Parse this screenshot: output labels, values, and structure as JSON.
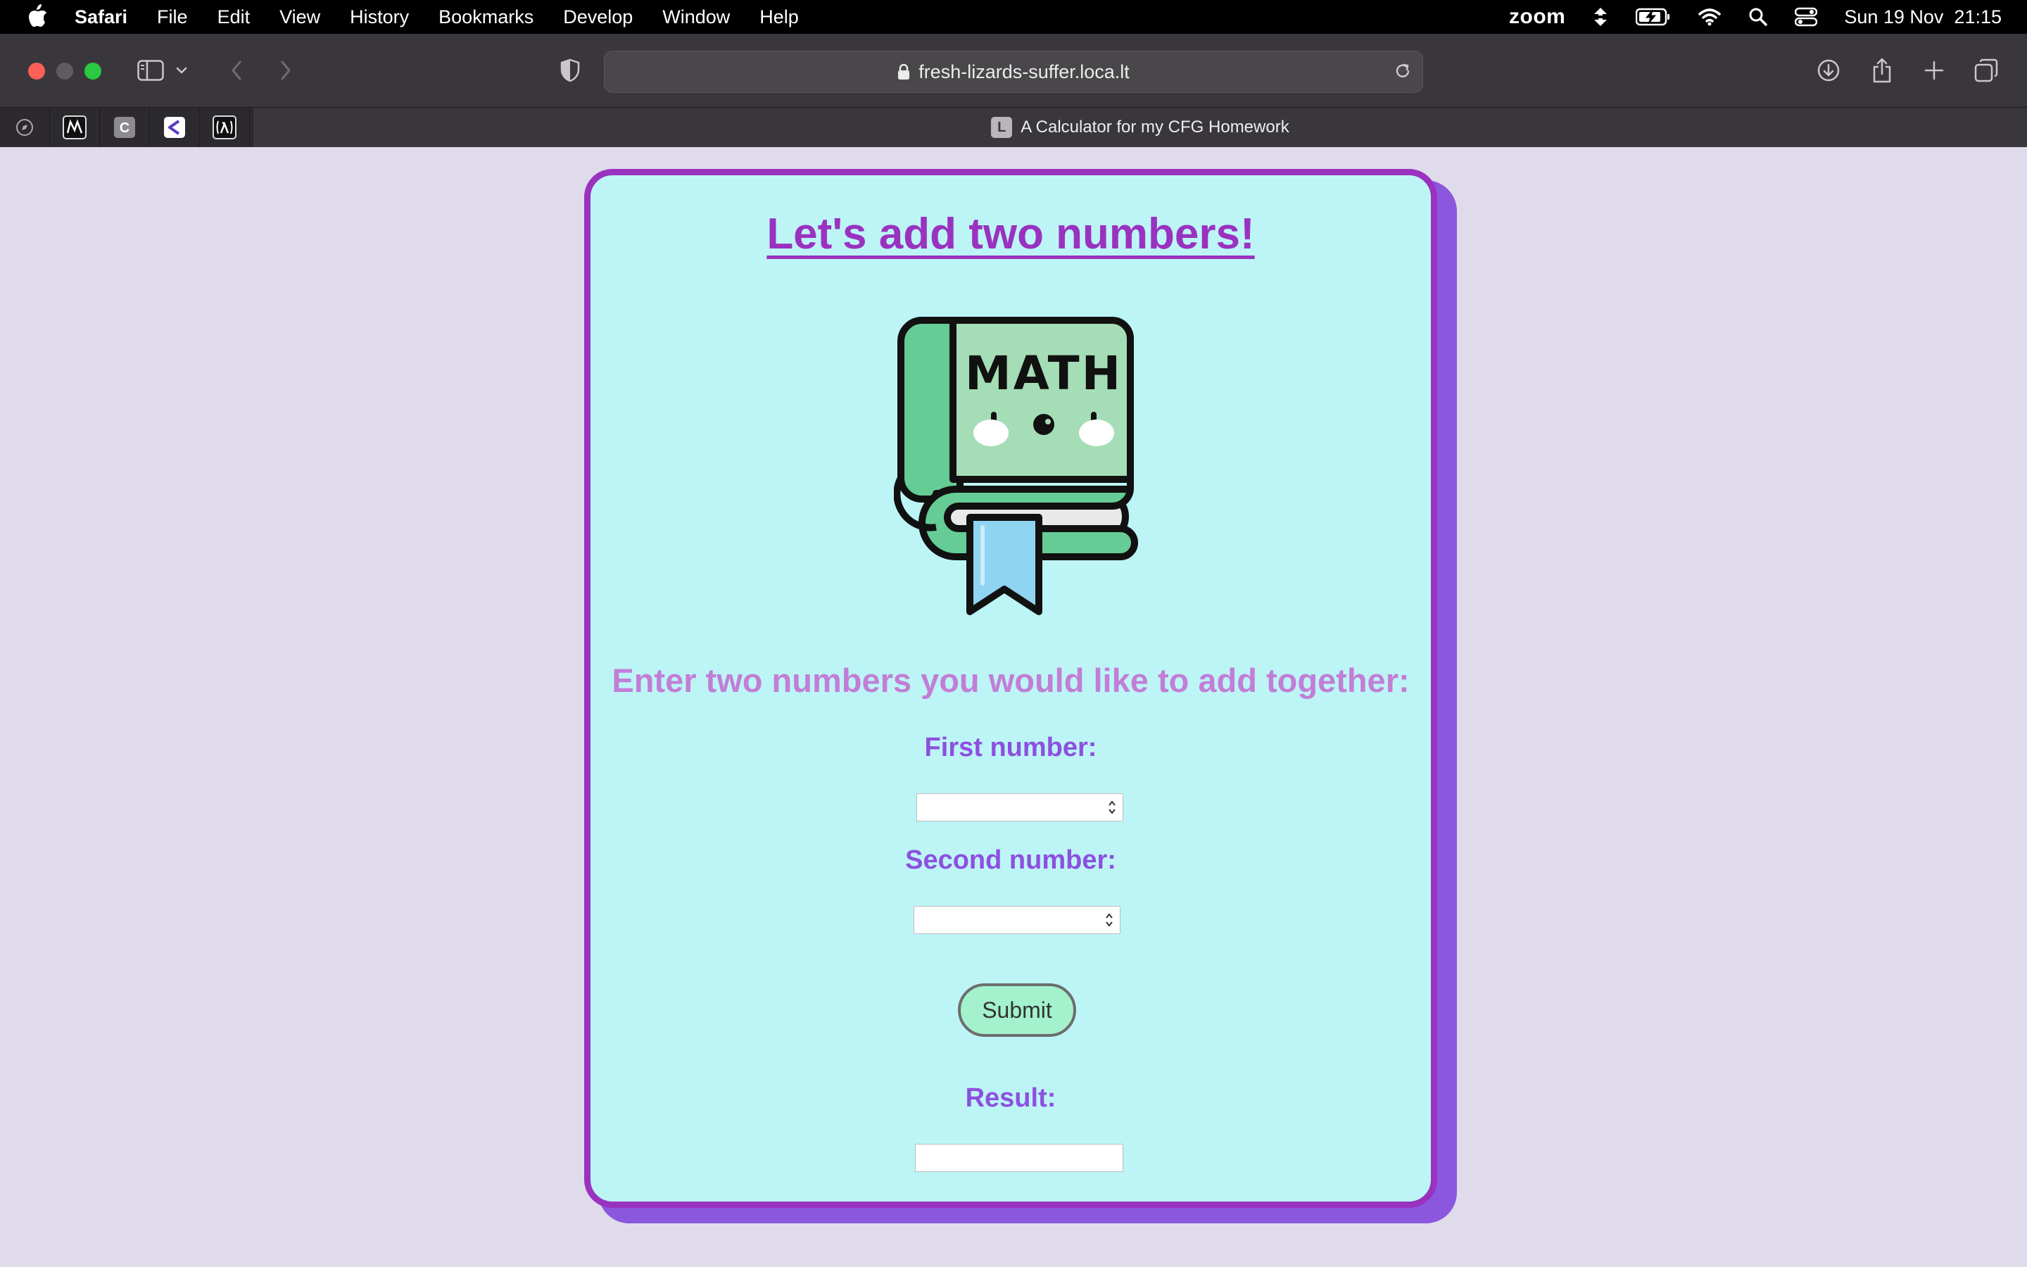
{
  "menubar": {
    "app_name": "Safari",
    "menus": [
      "File",
      "Edit",
      "View",
      "History",
      "Bookmarks",
      "Develop",
      "Window",
      "Help"
    ],
    "zoom_label": "zoom",
    "datetime": "Sun 19 Nov  21:15"
  },
  "toolbar": {
    "url": "fresh-lizards-suffer.loca.lt"
  },
  "tabs": {
    "active_title": "A Calculator for my CFG Homework",
    "active_favicon_letter": "L",
    "pinned": [
      "safari-icon",
      "m-icon",
      "c-icon",
      "chevron-app-icon",
      "lambda-icon"
    ]
  },
  "page": {
    "title": "Let's add two numbers!",
    "illustration_text": "MATH",
    "prompt": "Enter two numbers you would like to add together:",
    "first_label": "First number:",
    "first_value": "",
    "second_label": "Second number:",
    "second_value": "",
    "submit_label": "Submit",
    "result_label": "Result:",
    "result_value": ""
  },
  "colors": {
    "page_background": "#e0dbea",
    "card_background": "#bdf5f7",
    "card_border": "#9a32c0",
    "card_shadow": "#8b57de",
    "title": "#9a32c0",
    "prompt": "#c27ed6",
    "labels": "#8c50e0",
    "submit_button": "#a3f2cd"
  }
}
